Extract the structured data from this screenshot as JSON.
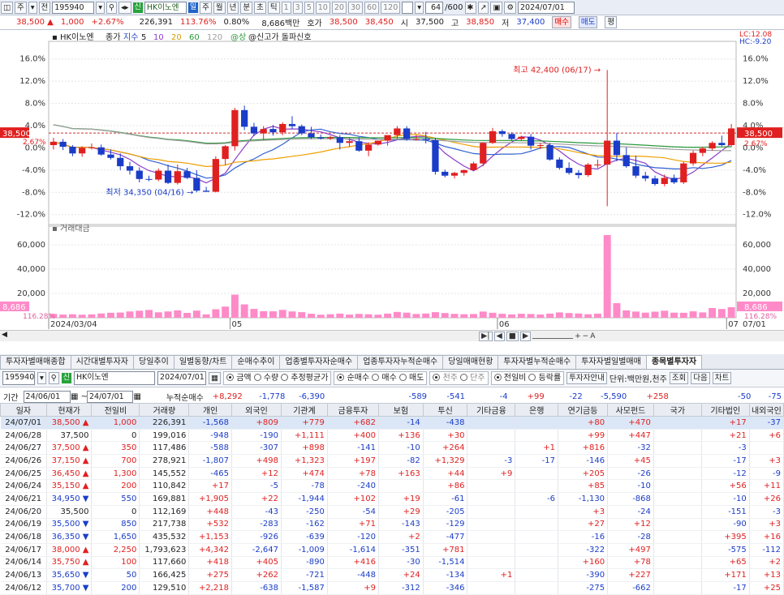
{
  "toolbar1": {
    "period_buttons": [
      "주",
      "전"
    ],
    "code": "195940",
    "stock_name": "HK이노엔",
    "flag_sin": "신",
    "unit_buttons": [
      "일",
      "주",
      "월",
      "년",
      "분",
      "초",
      "틱"
    ],
    "interval_buttons": [
      "1",
      "3",
      "5",
      "10",
      "20",
      "30",
      "60",
      "120"
    ],
    "count": "64",
    "count_total": "/600",
    "date": "2024/07/01"
  },
  "quote": {
    "price": "38,500",
    "change": "1,000",
    "change_pct": "+2.67%",
    "volume": "226,391",
    "vol_ratio": "113.76%",
    "turnover": "0.80%",
    "amount": "8,686백만",
    "ask_label": "호가",
    "ask1": "38,500",
    "bid1": "38,450",
    "open_label": "시",
    "open": "37,500",
    "high_label": "고",
    "high": "38,850",
    "low_label": "저",
    "low": "37,400",
    "buy_label": "매수",
    "sell_label": "매도",
    "avg_label": "평"
  },
  "chart_data": [
    {
      "type": "candlestick",
      "title": "HK이노엔",
      "legend": [
        "종가",
        "지수",
        "5",
        "10",
        "20",
        "60",
        "120",
        "@상",
        "@신고가 돌파신호"
      ],
      "lc_label": "LC:12.08",
      "hc_label": "HC:-9.20",
      "y_ticks": [
        "16.0%",
        "12.0%",
        "8.0%",
        "4.0%",
        "0.0%",
        "-4.0%",
        "-8.0%",
        "-12.0%"
      ],
      "ylim": [
        -13.5,
        18
      ],
      "current_tag": "38,500",
      "current_pct": "2.67%",
      "annotation_high": "최고 42,400 (06/17)",
      "annotation_low": "최저 34,350 (04/16)",
      "x_labels": [
        "2024/03/04",
        "05",
        "06",
        "07"
      ],
      "candles_pct": [
        [
          0.5,
          1.8,
          -0.3,
          1.1
        ],
        [
          1.1,
          1.6,
          -0.4,
          0.2
        ],
        [
          0.2,
          0.5,
          -1.5,
          -1.0
        ],
        [
          -1.0,
          0.3,
          -1.6,
          0.0
        ],
        [
          0.0,
          0.8,
          -0.3,
          0.1
        ],
        [
          0.1,
          0.6,
          -1.4,
          -1.2
        ],
        [
          -1.2,
          -0.3,
          -2.1,
          -1.8
        ],
        [
          -1.8,
          -1.0,
          -4.0,
          -3.3
        ],
        [
          -3.3,
          -2.5,
          -4.8,
          -4.1
        ],
        [
          -4.1,
          -3.5,
          -6.2,
          -5.6
        ],
        [
          -5.6,
          -5.0,
          -6.0,
          -5.7
        ],
        [
          -5.7,
          -3.7,
          -6.0,
          -4.1
        ],
        [
          -4.1,
          -3.0,
          -6.5,
          -6.3
        ],
        [
          -6.3,
          -3.0,
          -6.6,
          -4.2
        ],
        [
          -4.2,
          -3.6,
          -5.6,
          -5.4
        ],
        [
          -5.4,
          -4.0,
          -8.0,
          -7.7
        ],
        [
          -7.7,
          -7.0,
          -7.9,
          -7.9
        ],
        [
          -7.9,
          -1.5,
          -8.0,
          -2.0
        ],
        [
          -2.0,
          0.5,
          -3.1,
          0.3
        ],
        [
          0.3,
          7.2,
          -0.5,
          6.8
        ],
        [
          6.8,
          7.6,
          3.2,
          3.8
        ],
        [
          3.8,
          4.5,
          2.1,
          2.6
        ],
        [
          2.6,
          3.9,
          1.4,
          3.4
        ],
        [
          3.4,
          4.1,
          2.2,
          2.8
        ],
        [
          2.8,
          4.6,
          2.3,
          4.3
        ],
        [
          4.3,
          5.7,
          3.4,
          3.9
        ],
        [
          3.9,
          4.2,
          2.3,
          2.6
        ],
        [
          2.6,
          3.8,
          1.6,
          1.9
        ],
        [
          1.9,
          2.4,
          1.5,
          1.7
        ],
        [
          1.7,
          2.2,
          1.4,
          1.9
        ],
        [
          1.9,
          2.3,
          -0.3,
          0.9
        ],
        [
          0.9,
          1.8,
          0.2,
          1.2
        ],
        [
          1.2,
          1.9,
          -0.7,
          -0.5
        ],
        [
          -0.5,
          1.0,
          -1.5,
          0.6
        ],
        [
          0.6,
          1.3,
          0.4,
          1.3
        ],
        [
          1.3,
          2.0,
          0.4,
          2.3
        ],
        [
          2.3,
          3.9,
          1.6,
          3.5
        ],
        [
          3.5,
          3.9,
          1.3,
          1.6
        ],
        [
          1.6,
          2.3,
          1.3,
          1.6
        ],
        [
          1.6,
          2.9,
          0.8,
          1.4
        ],
        [
          1.4,
          1.8,
          -4.8,
          -4.3
        ],
        [
          -4.3,
          -3.9,
          -5.3,
          -5.0
        ],
        [
          -5.0,
          -4.3,
          -5.5,
          -4.5
        ],
        [
          -4.5,
          -3.9,
          -5.0,
          -4.0
        ],
        [
          -4.0,
          -2.5,
          -4.2,
          -2.8
        ],
        [
          -2.8,
          1.0,
          -3.3,
          0.9
        ],
        [
          0.9,
          3.6,
          0.7,
          3.0
        ],
        [
          3.0,
          3.3,
          2.0,
          2.5
        ],
        [
          2.5,
          2.8,
          1.4,
          1.6
        ],
        [
          1.6,
          2.2,
          1.3,
          2.0
        ],
        [
          2.0,
          2.5,
          -0.3,
          0.4
        ],
        [
          0.4,
          0.9,
          -0.2,
          0.5
        ],
        [
          0.5,
          0.9,
          -2.3,
          -2.1
        ],
        [
          -2.1,
          -1.7,
          -3.9,
          -3.6
        ],
        [
          -3.6,
          -2.6,
          -4.8,
          -4.5
        ],
        [
          -4.5,
          -4.0,
          -5.5,
          -4.9
        ],
        [
          -4.9,
          -2.7,
          -5.2,
          -3.0
        ],
        [
          -3.0,
          -2.1,
          -3.6,
          -3.0
        ],
        [
          -3.0,
          14.0,
          -10.5,
          1.3
        ],
        [
          1.3,
          2.7,
          -2.4,
          -1.3
        ],
        [
          -1.3,
          0.1,
          -3.6,
          -3.3
        ],
        [
          -3.3,
          -1.4,
          -5.4,
          -5.0
        ],
        [
          -5.0,
          -4.3,
          -6.0,
          -5.5
        ],
        [
          -5.5,
          -5.0,
          -6.8,
          -6.5
        ],
        [
          -6.5,
          -4.8,
          -6.9,
          -5.4
        ],
        [
          -5.4,
          -4.8,
          -6.5,
          -6.2
        ],
        [
          -6.2,
          -2.5,
          -6.5,
          -2.8
        ],
        [
          -2.8,
          -0.5,
          -3.2,
          -0.9
        ],
        [
          -0.9,
          0.2,
          -1.5,
          -0.1
        ],
        [
          -0.1,
          1.2,
          -0.5,
          0.9
        ],
        [
          0.9,
          2.2,
          0.3,
          0.5
        ],
        [
          0.5,
          4.3,
          0.2,
          3.5
        ]
      ]
    },
    {
      "type": "bar",
      "title": "거래대금",
      "y_ticks": [
        "60,000",
        "40,000",
        "20,000"
      ],
      "ylim": [
        0,
        70000
      ],
      "current_tag": "8,686",
      "current_pct": "116.28%",
      "values": [
        3200,
        2600,
        2900,
        2500,
        2800,
        3500,
        4100,
        4300,
        5200,
        5800,
        6400,
        4500,
        5200,
        6100,
        4000,
        5900,
        2800,
        7000,
        9200,
        19000,
        11000,
        7300,
        5400,
        5300,
        6500,
        5200,
        4600,
        3300,
        2500,
        2900,
        3400,
        2600,
        3200,
        2900,
        2500,
        3400,
        4800,
        4200,
        3100,
        3500,
        4600,
        3900,
        3200,
        2900,
        3100,
        5100,
        4100,
        3300,
        2700,
        3300,
        3100,
        2700,
        3400,
        4400,
        3900,
        3500,
        2900,
        3400,
        68000,
        12000,
        6100,
        5100,
        4200,
        5000,
        5800,
        4200,
        4100,
        5300,
        4400,
        8000,
        7200,
        8686
      ]
    }
  ],
  "tabs": [
    "투자자별매매종합",
    "시간대별투자자",
    "당일추이",
    "일별동향/차트",
    "순매수추이",
    "업종별투자자순매수",
    "업종투자자누적순매수",
    "당일매매현황",
    "투자자별누적순매수",
    "투자자별일별매매",
    "종목별투자자"
  ],
  "filter": {
    "code": "195940",
    "stock_name": "HK이노엔",
    "flag_sin": "신",
    "date": "2024/07/01",
    "opt_amount": "금액",
    "opt_qty": "수량",
    "opt_avg": "추정평균가",
    "opt_net": "순매수",
    "opt_buy": "매수",
    "opt_sell": "매도",
    "opt_thousand": "천주",
    "opt_single": "단주",
    "opt_prev": "전일비",
    "opt_rate": "등락률",
    "guide_button": "투자자안내",
    "unit": "단위:백만원,천주",
    "query_button": "조회",
    "next_button": "다음",
    "chart_button": "차트"
  },
  "period": {
    "label": "기간",
    "from": "24/06/01",
    "to": "24/07/01",
    "cum_label": "누적순매수",
    "cum": [
      "+8,292",
      "-1,778",
      "-6,390",
      "",
      "-589",
      "-541",
      "-4",
      "+99",
      "-22",
      "-5,590",
      "+258",
      "",
      "-50",
      "-75"
    ]
  },
  "table": {
    "headers": [
      "일자",
      "현재가",
      "전일비",
      "거래량",
      "개인",
      "외국인",
      "기관계",
      "금융투자",
      "보험",
      "투신",
      "기타금융",
      "은행",
      "연기금등",
      "사모펀드",
      "국가",
      "기타법인",
      "내외국인"
    ],
    "rows": [
      [
        "24/07/01",
        "38,500",
        "▲",
        "1,000",
        "226,391",
        "-1,568",
        "+809",
        "+779",
        "+682",
        "-14",
        "-438",
        "",
        "",
        "+80",
        "+470",
        "",
        "+17",
        "-37"
      ],
      [
        "24/06/28",
        "37,500",
        "",
        "0",
        "199,016",
        "-948",
        "-190",
        "+1,111",
        "+400",
        "+136",
        "+30",
        "",
        "",
        "+99",
        "+447",
        "",
        "+21",
        "+6"
      ],
      [
        "24/06/27",
        "37,500",
        "▲",
        "350",
        "117,486",
        "-588",
        "-307",
        "+898",
        "-141",
        "-10",
        "+264",
        "",
        "+1",
        "+816",
        "-32",
        "",
        "-3",
        ""
      ],
      [
        "24/06/26",
        "37,150",
        "▲",
        "700",
        "278,921",
        "-1,807",
        "+498",
        "+1,323",
        "+197",
        "-82",
        "+1,329",
        "-3",
        "-17",
        "-146",
        "+45",
        "",
        "-17",
        "+3"
      ],
      [
        "24/06/25",
        "36,450",
        "▲",
        "1,300",
        "145,552",
        "-465",
        "+12",
        "+474",
        "+78",
        "+163",
        "+44",
        "+9",
        "",
        "+205",
        "-26",
        "",
        "-12",
        "-9"
      ],
      [
        "24/06/24",
        "35,150",
        "▲",
        "200",
        "110,842",
        "+17",
        "-5",
        "-78",
        "-240",
        "",
        "+86",
        "",
        "",
        "+85",
        "-10",
        "",
        "+56",
        "+11"
      ],
      [
        "24/06/21",
        "34,950",
        "▼",
        "550",
        "169,881",
        "+1,905",
        "+22",
        "-1,944",
        "+102",
        "+19",
        "-61",
        "",
        "-6",
        "-1,130",
        "-868",
        "",
        "-10",
        "+26"
      ],
      [
        "24/06/20",
        "35,500",
        "",
        "0",
        "112,169",
        "+448",
        "-43",
        "-250",
        "-54",
        "+29",
        "-205",
        "",
        "",
        "+3",
        "-24",
        "",
        "-151",
        "-3"
      ],
      [
        "24/06/19",
        "35,500",
        "▼",
        "850",
        "217,738",
        "+532",
        "-283",
        "-162",
        "+71",
        "-143",
        "-129",
        "",
        "",
        "+27",
        "+12",
        "",
        "-90",
        "+3"
      ],
      [
        "24/06/18",
        "36,350",
        "▼",
        "1,650",
        "435,532",
        "+1,153",
        "-926",
        "-639",
        "-120",
        "+2",
        "-477",
        "",
        "",
        "-16",
        "-28",
        "",
        "+395",
        "+16"
      ],
      [
        "24/06/17",
        "38,000",
        "▲",
        "2,250",
        "1,793,623",
        "+4,342",
        "-2,647",
        "-1,009",
        "-1,614",
        "-351",
        "+781",
        "",
        "",
        "-322",
        "+497",
        "",
        "-575",
        "-112"
      ],
      [
        "24/06/14",
        "35,750",
        "▲",
        "100",
        "117,660",
        "+418",
        "+405",
        "-890",
        "+416",
        "-30",
        "-1,514",
        "",
        "",
        "+160",
        "+78",
        "",
        "+65",
        "+2"
      ],
      [
        "24/06/13",
        "35,650",
        "▼",
        "50",
        "166,425",
        "+275",
        "+262",
        "-721",
        "-448",
        "+24",
        "-134",
        "+1",
        "",
        "-390",
        "+227",
        "",
        "+171",
        "+13"
      ],
      [
        "24/06/12",
        "35,700",
        "▼",
        "200",
        "129,510",
        "+2,218",
        "-638",
        "-1,587",
        "+9",
        "-312",
        "-346",
        "",
        "",
        "-275",
        "-662",
        "",
        "-17",
        "+25"
      ]
    ]
  },
  "colors": {
    "up": "#e02020",
    "down": "#1a3cc8",
    "ma5": "#8a3cc8",
    "ma20": "#f0a000",
    "ma60": "#2a9a3a",
    "ma120": "#a0a0a0",
    "volbar": "#ff8ac8"
  }
}
